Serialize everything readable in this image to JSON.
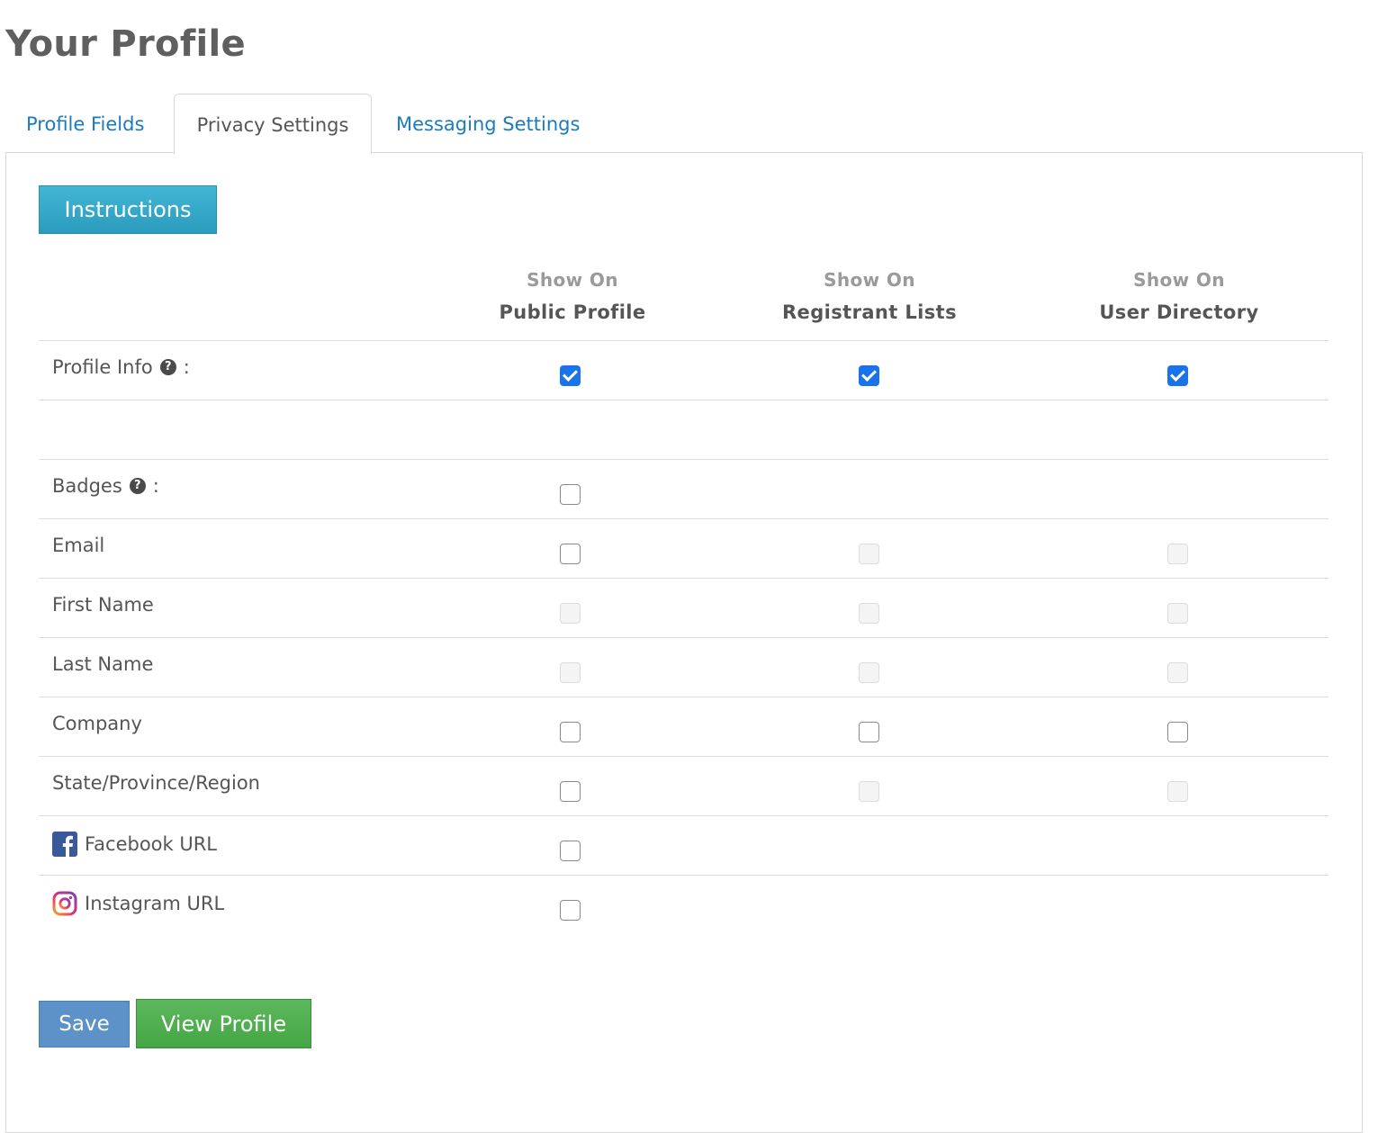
{
  "page": {
    "title": "Your Profile"
  },
  "tabs": [
    {
      "label": "Profile Fields",
      "active": false
    },
    {
      "label": "Privacy Settings",
      "active": true
    },
    {
      "label": "Messaging Settings",
      "active": false
    }
  ],
  "panel": {
    "instructions_label": "Instructions"
  },
  "columns": [
    {
      "line1": "Show On",
      "line2": "Public Profile"
    },
    {
      "line1": "Show On",
      "line2": "Registrant Lists"
    },
    {
      "line1": "Show On",
      "line2": "User Directory"
    }
  ],
  "rows": [
    {
      "label": "Profile Info",
      "help": "?",
      "suffix": ":",
      "cells": [
        "checked",
        "checked",
        "checked"
      ]
    },
    {
      "label": "",
      "cells": [
        "none",
        "none",
        "none"
      ]
    },
    {
      "label": "Badges",
      "help": "?",
      "suffix": ":",
      "cells": [
        "unchecked",
        "none",
        "none"
      ]
    },
    {
      "label": "Email",
      "cells": [
        "unchecked",
        "disabled",
        "disabled"
      ]
    },
    {
      "label": "First Name",
      "cells": [
        "disabled",
        "disabled",
        "disabled"
      ]
    },
    {
      "label": "Last Name",
      "cells": [
        "disabled",
        "disabled",
        "disabled"
      ]
    },
    {
      "label": "Company",
      "cells": [
        "unchecked",
        "unchecked",
        "unchecked"
      ]
    },
    {
      "label": "State/Province/Region",
      "cells": [
        "unchecked",
        "disabled",
        "disabled"
      ]
    },
    {
      "label": "Facebook URL",
      "icon": "facebook-icon",
      "cells": [
        "unchecked",
        "none",
        "none"
      ]
    },
    {
      "label": "Instagram URL",
      "icon": "instagram-icon",
      "cells": [
        "unchecked",
        "none",
        "none"
      ]
    }
  ],
  "actions": {
    "save_label": "Save",
    "view_profile_label": "View Profile"
  },
  "colors": {
    "link": "#1b7bbd",
    "checkbox_checked": "#1a73e8",
    "instructions_button": "#2a9bbd",
    "save_button": "#5c92c7",
    "view_profile_button": "#45a645"
  }
}
